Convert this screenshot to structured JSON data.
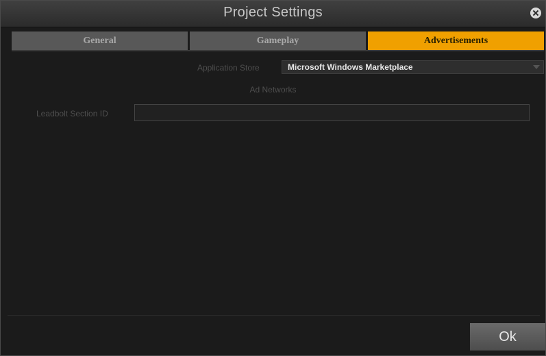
{
  "window": {
    "title": "Project Settings"
  },
  "tabs": [
    {
      "label": "General",
      "active": false
    },
    {
      "label": "Gameplay",
      "active": false
    },
    {
      "label": "Advertisements",
      "active": true
    }
  ],
  "advertisements": {
    "store_label": "Application Store",
    "store_value": "Microsoft Windows Marketplace",
    "ad_networks_heading": "Ad Networks",
    "leadbolt_label": "Leadbolt Section ID",
    "leadbolt_value": ""
  },
  "footer": {
    "ok_label": "Ok"
  },
  "colors": {
    "accent": "#f0a000",
    "background": "#1b1b1b"
  }
}
